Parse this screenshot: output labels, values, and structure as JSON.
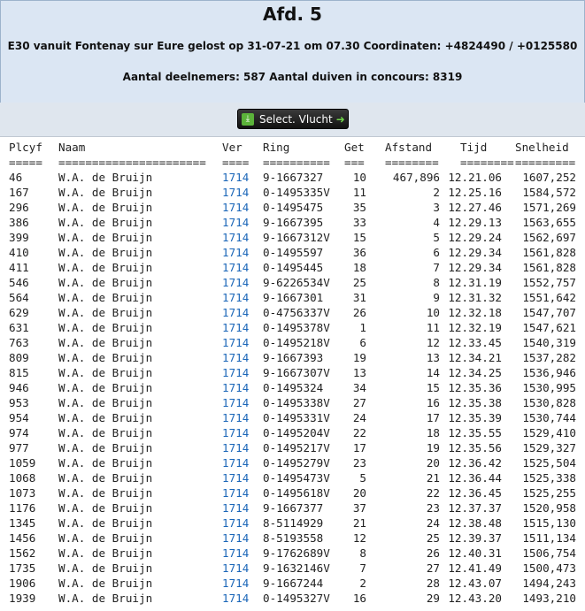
{
  "header": {
    "title": "Afd. 5",
    "subtitle": "E30 vanuit Fontenay sur Eure gelost op 31-07-21 om 07.30 Coordinaten: +4824490 / +0125580",
    "subtitle2": "Aantal deelnemers: 587 Aantal duiven in concours: 8319"
  },
  "button": {
    "label": "Select. Vlucht"
  },
  "columns": [
    "Plcyf",
    "Naam",
    "Ver",
    "Ring",
    "Get",
    "Afstand",
    "Tijd",
    "Snelheid"
  ],
  "separators": [
    "=====",
    "======================",
    "====",
    "==========",
    "===",
    "========",
    "========",
    "========="
  ],
  "rows": [
    [
      "46",
      "W.A. de Bruijn",
      "1714",
      "9-1667327",
      "10",
      "467,896",
      "12.21.06",
      "1607,252"
    ],
    [
      "167",
      "W.A. de Bruijn",
      "1714",
      "0-1495335V",
      "11",
      "2",
      "12.25.16",
      "1584,572"
    ],
    [
      "296",
      "W.A. de Bruijn",
      "1714",
      "0-1495475",
      "35",
      "3",
      "12.27.46",
      "1571,269"
    ],
    [
      "386",
      "W.A. de Bruijn",
      "1714",
      "9-1667395",
      "33",
      "4",
      "12.29.13",
      "1563,655"
    ],
    [
      "399",
      "W.A. de Bruijn",
      "1714",
      "9-1667312V",
      "15",
      "5",
      "12.29.24",
      "1562,697"
    ],
    [
      "410",
      "W.A. de Bruijn",
      "1714",
      "0-1495597",
      "36",
      "6",
      "12.29.34",
      "1561,828"
    ],
    [
      "411",
      "W.A. de Bruijn",
      "1714",
      "0-1495445",
      "18",
      "7",
      "12.29.34",
      "1561,828"
    ],
    [
      "546",
      "W.A. de Bruijn",
      "1714",
      "9-6226534V",
      "25",
      "8",
      "12.31.19",
      "1552,757"
    ],
    [
      "564",
      "W.A. de Bruijn",
      "1714",
      "9-1667301",
      "31",
      "9",
      "12.31.32",
      "1551,642"
    ],
    [
      "629",
      "W.A. de Bruijn",
      "1714",
      "0-4756337V",
      "26",
      "10",
      "12.32.18",
      "1547,707"
    ],
    [
      "631",
      "W.A. de Bruijn",
      "1714",
      "0-1495378V",
      "1",
      "11",
      "12.32.19",
      "1547,621"
    ],
    [
      "763",
      "W.A. de Bruijn",
      "1714",
      "0-1495218V",
      "6",
      "12",
      "12.33.45",
      "1540,319"
    ],
    [
      "809",
      "W.A. de Bruijn",
      "1714",
      "9-1667393",
      "19",
      "13",
      "12.34.21",
      "1537,282"
    ],
    [
      "815",
      "W.A. de Bruijn",
      "1714",
      "9-1667307V",
      "13",
      "14",
      "12.34.25",
      "1536,946"
    ],
    [
      "946",
      "W.A. de Bruijn",
      "1714",
      "0-1495324",
      "34",
      "15",
      "12.35.36",
      "1530,995"
    ],
    [
      "953",
      "W.A. de Bruijn",
      "1714",
      "0-1495338V",
      "27",
      "16",
      "12.35.38",
      "1530,828"
    ],
    [
      "954",
      "W.A. de Bruijn",
      "1714",
      "0-1495331V",
      "24",
      "17",
      "12.35.39",
      "1530,744"
    ],
    [
      "974",
      "W.A. de Bruijn",
      "1714",
      "0-1495204V",
      "22",
      "18",
      "12.35.55",
      "1529,410"
    ],
    [
      "977",
      "W.A. de Bruijn",
      "1714",
      "0-1495217V",
      "17",
      "19",
      "12.35.56",
      "1529,327"
    ],
    [
      "1059",
      "W.A. de Bruijn",
      "1714",
      "0-1495279V",
      "23",
      "20",
      "12.36.42",
      "1525,504"
    ],
    [
      "1068",
      "W.A. de Bruijn",
      "1714",
      "0-1495473V",
      "5",
      "21",
      "12.36.44",
      "1525,338"
    ],
    [
      "1073",
      "W.A. de Bruijn",
      "1714",
      "0-1495618V",
      "20",
      "22",
      "12.36.45",
      "1525,255"
    ],
    [
      "1176",
      "W.A. de Bruijn",
      "1714",
      "9-1667377",
      "37",
      "23",
      "12.37.37",
      "1520,958"
    ],
    [
      "1345",
      "W.A. de Bruijn",
      "1714",
      "8-5114929",
      "21",
      "24",
      "12.38.48",
      "1515,130"
    ],
    [
      "1456",
      "W.A. de Bruijn",
      "1714",
      "8-5193558",
      "12",
      "25",
      "12.39.37",
      "1511,134"
    ],
    [
      "1562",
      "W.A. de Bruijn",
      "1714",
      "9-1762689V",
      "8",
      "26",
      "12.40.31",
      "1506,754"
    ],
    [
      "1735",
      "W.A. de Bruijn",
      "1714",
      "9-1632146V",
      "7",
      "27",
      "12.41.49",
      "1500,473"
    ],
    [
      "1906",
      "W.A. de Bruijn",
      "1714",
      "9-1667244",
      "2",
      "28",
      "12.43.07",
      "1494,243"
    ],
    [
      "1939",
      "W.A. de Bruijn",
      "1714",
      "0-1495327V",
      "16",
      "29",
      "12.43.20",
      "1493,210"
    ]
  ]
}
